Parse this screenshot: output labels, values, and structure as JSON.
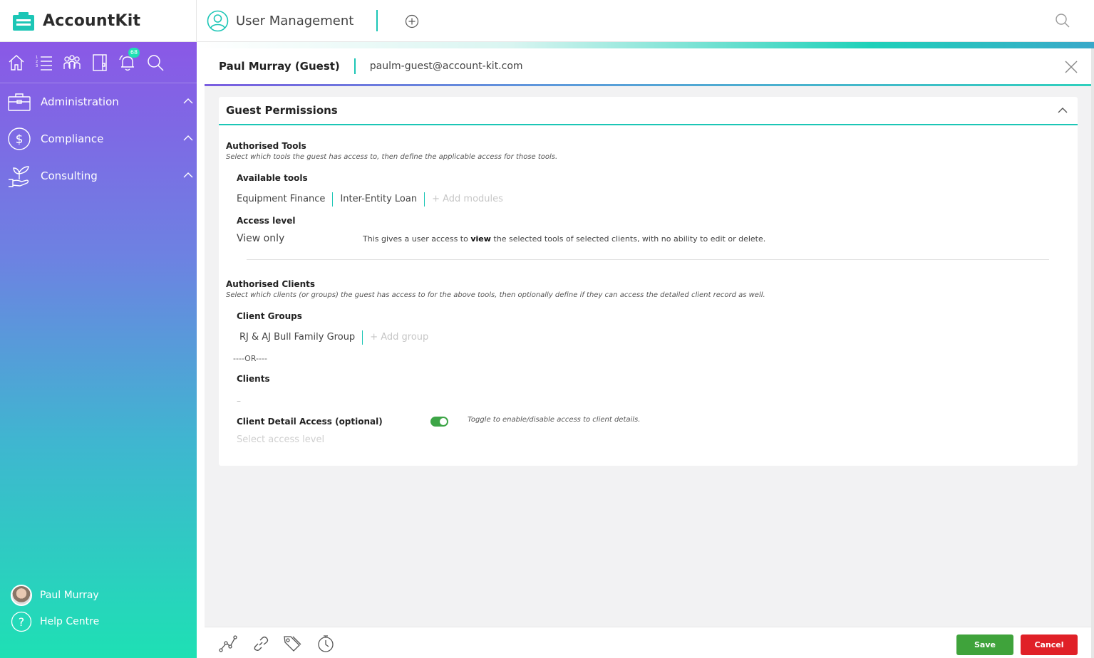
{
  "app": {
    "name": "AccountKit",
    "page_title": "User Management"
  },
  "sidebar": {
    "notification_count": "68",
    "items": [
      {
        "label": "Administration"
      },
      {
        "label": "Compliance"
      },
      {
        "label": "Consulting"
      }
    ],
    "footer": {
      "user_name": "Paul Murray",
      "help_label": "Help Centre"
    }
  },
  "guest": {
    "name": "Paul Murray (Guest)",
    "email": "paulm-guest@account-kit.com"
  },
  "panel": {
    "title": "Guest Permissions",
    "tools": {
      "title": "Authorised Tools",
      "description": "Select which tools the guest has access to, then define the applicable access for those tools.",
      "available_label": "Available tools",
      "items": [
        "Equipment Finance",
        "Inter-Entity Loan"
      ],
      "add_label": "+ Add modules",
      "access_label": "Access level",
      "access_value": "View only",
      "access_note_pre": "This gives a user access to ",
      "access_note_bold": "view",
      "access_note_post": " the selected tools of selected clients, with no ability to edit or delete."
    },
    "clients": {
      "title": "Authorised Clients",
      "description": "Select which clients (or groups) the guest has access to for the above tools, then optionally define if they can access the detailed client record as well.",
      "groups_label": "Client Groups",
      "groups": [
        "RJ & AJ Bull Family Group"
      ],
      "add_group_label": "+ Add group",
      "or_label": "----OR----",
      "clients_label": "Clients",
      "clients_value": "–",
      "detail_label": "Client Detail Access (optional)",
      "detail_enabled": true,
      "toggle_note": "Toggle to enable/disable access to client details.",
      "access_placeholder": "Select access level"
    }
  },
  "actions": {
    "save": "Save",
    "cancel": "Cancel"
  },
  "colors": {
    "accent": "#1cc6b6",
    "save": "#3fa33b",
    "cancel": "#e02027",
    "sidebar_top": "#8a58e6",
    "sidebar_bottom": "#1ee0b4"
  }
}
